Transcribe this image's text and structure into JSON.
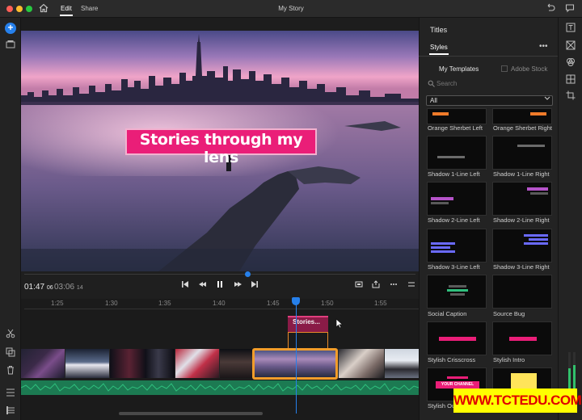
{
  "window": {
    "title": "My Story",
    "tabs": [
      {
        "label": "Edit",
        "active": true
      },
      {
        "label": "Share",
        "active": false
      }
    ]
  },
  "monitor": {
    "title_overlay_text": "Stories through my lens",
    "current_time": "01:47",
    "current_frames": "06",
    "duration": "03:06",
    "duration_frames": "14",
    "playhead_fraction": 0.57
  },
  "timeline": {
    "ruler_ticks": [
      "1:25",
      "1:30",
      "1:35",
      "1:40",
      "1:45",
      "1:50",
      "1:55"
    ],
    "title_clip_label": "Stories..."
  },
  "panel": {
    "heading": "Titles",
    "tab": "Styles",
    "subtabs": [
      "My Templates",
      "Adobe Stock"
    ],
    "search_placeholder": "Search",
    "filter_value": "All",
    "templates": [
      "Orange Sherbet Left",
      "Orange Sherbet Right",
      "Shadow 1-Line Left",
      "Shadow 1-Line Right",
      "Shadow 2-Line Left",
      "Shadow 2-Line Right",
      "Shadow 3-Line Left",
      "Shadow 3-Line Right",
      "Social Caption",
      "Source Bug",
      "Stylish Crisscross",
      "Stylish Intro",
      "Stylish Outro",
      ""
    ],
    "thumb_texts": {
      "youtube": "YOUR CHANNEL"
    }
  },
  "watermark": "WWW.TCTEDU.COM",
  "colors": {
    "accent": "#2680eb",
    "title_pink": "#ea1e78",
    "selected_clip": "#f29d2a",
    "audio_track": "#1c7a52",
    "watermark_bg": "#ffff00",
    "watermark_fg": "#e00000"
  },
  "icons": {
    "home": "home-icon",
    "add": "plus-icon",
    "undo": "undo-icon",
    "feedback": "chat-icon"
  }
}
